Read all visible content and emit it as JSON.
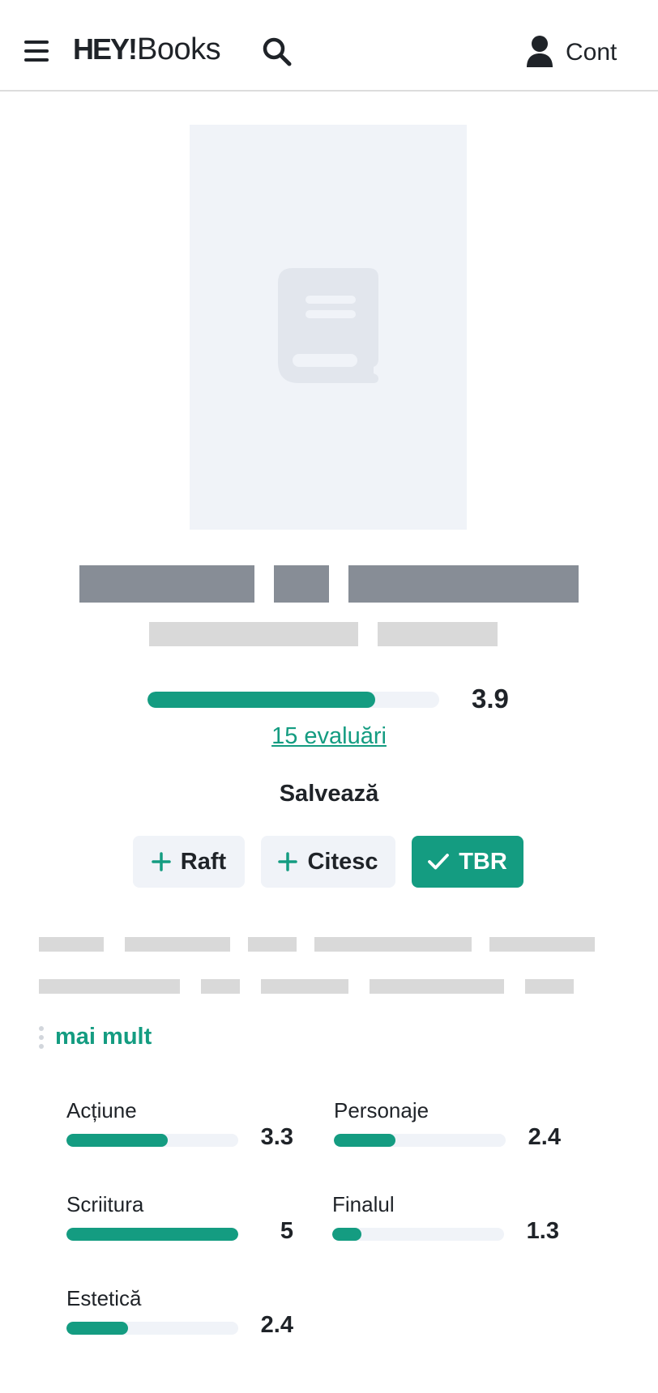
{
  "header": {
    "logo_hey": "HEY!",
    "logo_books": "Books",
    "account_label": "Cont"
  },
  "rating": {
    "value": "3.9",
    "fraction": 0.78,
    "count_link": "15 evaluări"
  },
  "save": {
    "label": "Salvează",
    "buttons": [
      {
        "label": "Raft",
        "icon": "plus-icon",
        "active": false
      },
      {
        "label": "Citesc",
        "icon": "plus-icon",
        "active": false
      },
      {
        "label": "TBR",
        "icon": "check-icon",
        "active": true
      }
    ]
  },
  "description": {
    "more_label": "mai mult"
  },
  "sub_ratings": [
    {
      "name": "Acțiune",
      "value": "3.3",
      "fraction": 0.59
    },
    {
      "name": "Personaje",
      "value": "2.4",
      "fraction": 0.36
    },
    {
      "name": "Scriitura",
      "value": "5",
      "fraction": 1.0
    },
    {
      "name": "Finalul",
      "value": "1.3",
      "fraction": 0.17
    },
    {
      "name": "Estetică",
      "value": "2.4",
      "fraction": 0.36
    }
  ],
  "colors": {
    "accent": "#149c81",
    "track": "#f0f3f8",
    "skeleton_dark": "#878d96",
    "skeleton_light": "#d9d9d9"
  }
}
